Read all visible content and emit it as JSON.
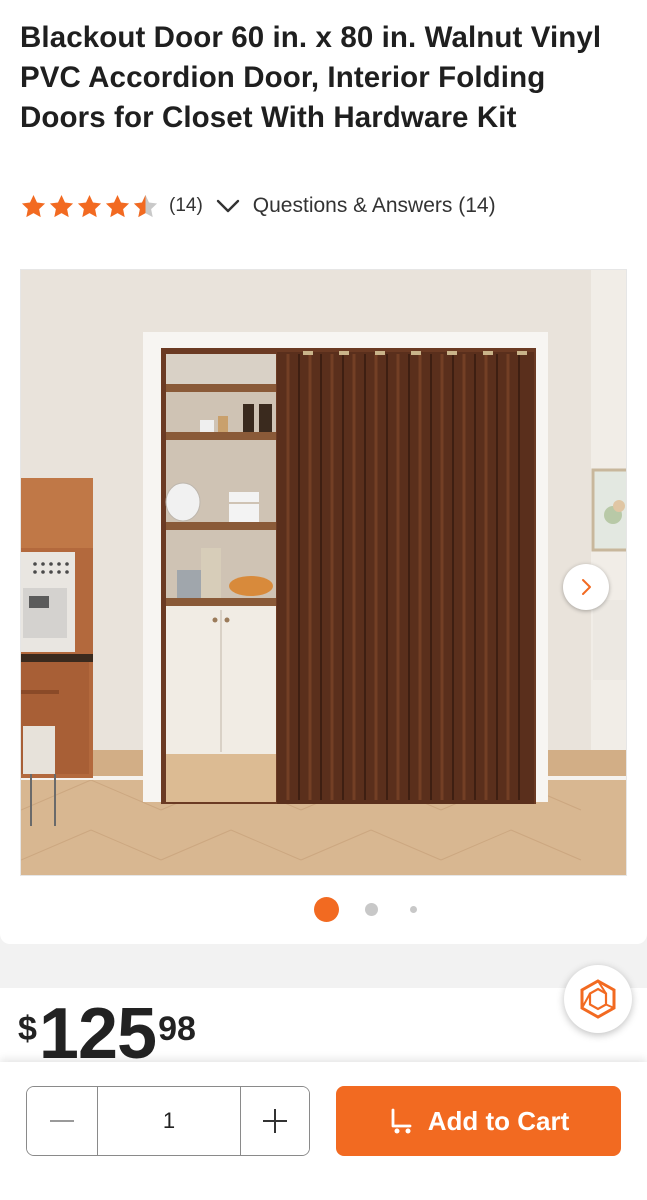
{
  "product": {
    "title": "Blackout Door 60 in. x 80 in. Walnut Vinyl PVC Accordion Door, Interior Folding Doors for Closet With Hardware Kit",
    "rating": {
      "stars": 4.5,
      "max": 5,
      "count_text": "(14)",
      "qa_text": "Questions & Answers (14)"
    },
    "gallery": {
      "image_count": 3,
      "current_index": 1,
      "next_icon": "chevron-right-icon"
    }
  },
  "price": {
    "dollar_sign": "$",
    "whole": "125",
    "cents": "98"
  },
  "help": {
    "icon": "hexagon-help-icon"
  },
  "cart_bar": {
    "quantity": "1",
    "minus_icon": "minus-icon",
    "plus_icon": "plus-icon",
    "add_to_cart_label": "Add to Cart",
    "cart_icon": "cart-icon"
  },
  "colors": {
    "accent": "#f26a21",
    "star": "#f26a21",
    "text": "#1f1f1f",
    "walnut": "#5a2f1c"
  }
}
